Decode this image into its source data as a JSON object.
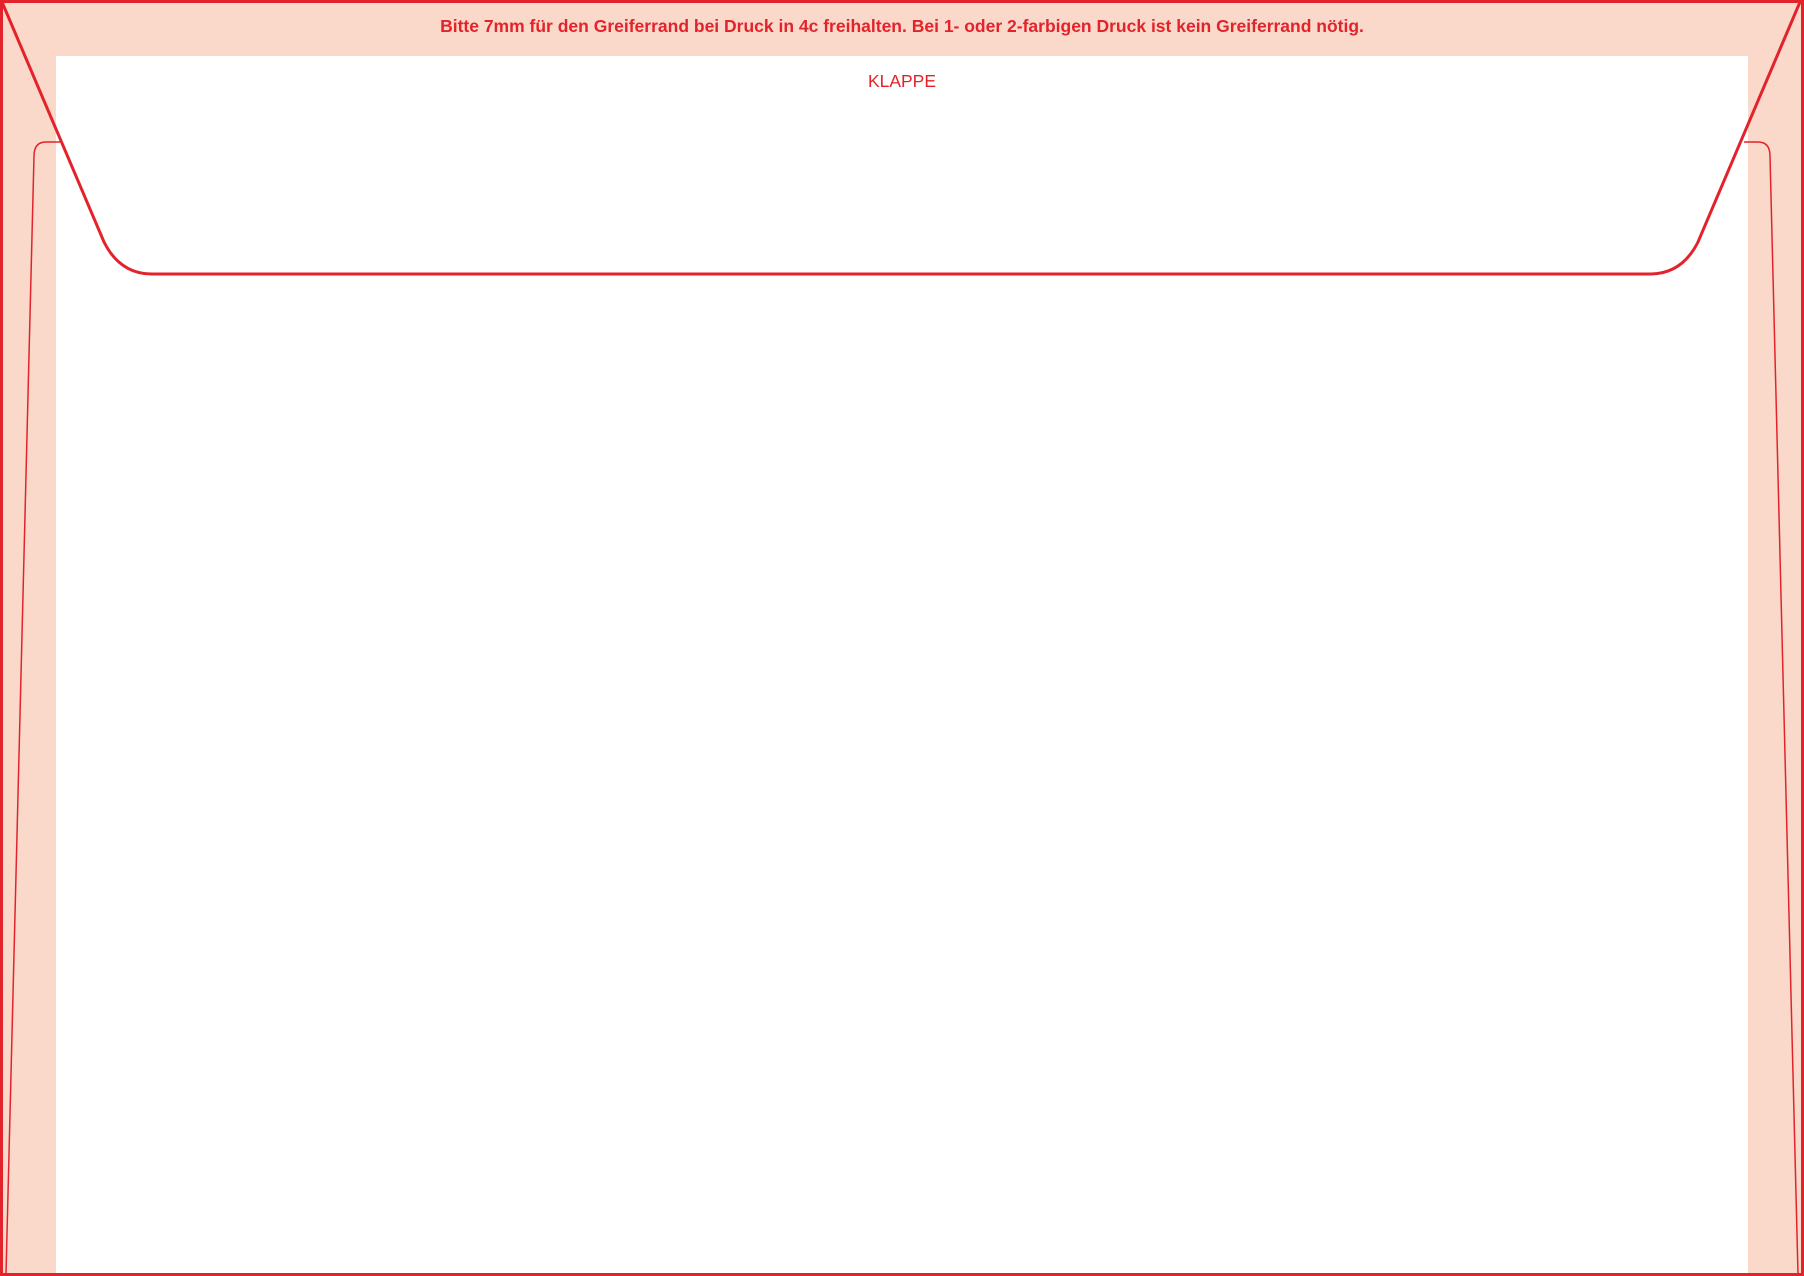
{
  "template": {
    "gripper_notice": "Bitte 7mm für den Greiferrand bei Druck in 4c freihalten. Bei 1- oder 2-farbigen Druck ist kein Greiferrand nötig.",
    "flap_label": "KLAPPE"
  },
  "colors": {
    "cut_line": "#e3232b",
    "margin_fill": "#fad9cb",
    "print_area": "#ffffff"
  }
}
